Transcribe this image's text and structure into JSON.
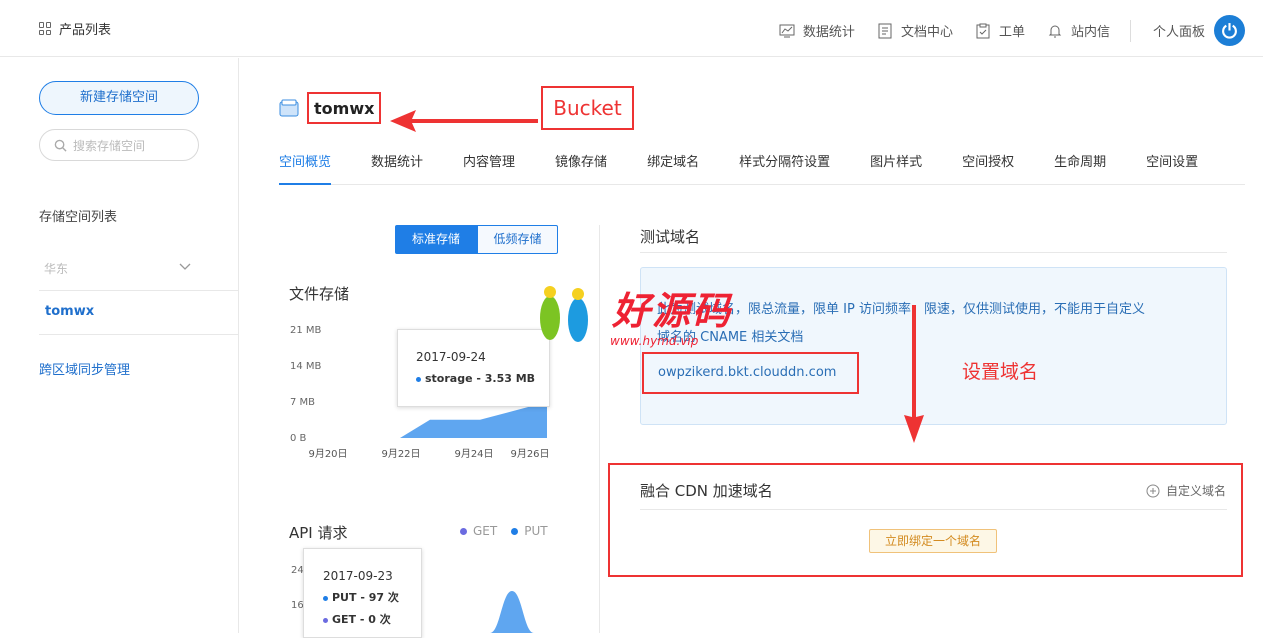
{
  "topbar": {
    "products_label": "产品列表",
    "nav": [
      {
        "label": "数据统计",
        "icon": "chart-icon"
      },
      {
        "label": "文档中心",
        "icon": "document-icon"
      },
      {
        "label": "工单",
        "icon": "ticket-icon"
      },
      {
        "label": "站内信",
        "icon": "bell-icon"
      }
    ],
    "user_panel": "个人面板"
  },
  "sidebar": {
    "new_bucket": "新建存储空间",
    "search_placeholder": "搜索存储空间",
    "list_title": "存储空间列表",
    "region": "华东",
    "bucket": "tomwx",
    "cross_region": "跨区域同步管理"
  },
  "main": {
    "bucket_name": "tomwx",
    "annotation_bucket": "Bucket",
    "tabs": [
      "空间概览",
      "数据统计",
      "内容管理",
      "镜像存储",
      "绑定域名",
      "样式分隔符设置",
      "图片样式",
      "空间授权",
      "生命周期",
      "空间设置"
    ],
    "active_tab": 0,
    "storage_toggle": {
      "standard": "标准存储",
      "low_freq": "低频存储"
    },
    "file_storage_title": "文件存储",
    "storage_tooltip": {
      "date": "2017-09-24",
      "value": "storage - 3.53 MB"
    },
    "api_title": "API 请求",
    "api_legend": [
      "GET",
      "PUT"
    ],
    "api_tooltip": {
      "date": "2017-09-23",
      "put": "PUT - 97 次",
      "get": "GET - 0 次"
    },
    "api_y_labels": [
      "24",
      "16"
    ]
  },
  "test_domain": {
    "title": "测试域名",
    "text_line1": "此为测试域名，限总流量，限单 IP 访问频率，限速，仅供测试使用，不能用于自定义",
    "text_line2": "域名的 CNAME 相关文档",
    "domain": "owpzikerd.bkt.clouddn.com",
    "annotation": "设置域名"
  },
  "cdn": {
    "title": "融合 CDN 加速域名",
    "custom": "自定义域名",
    "bind_button": "立即绑定一个域名"
  },
  "watermark": {
    "text": "好源码",
    "url": "www.hymd.vip"
  },
  "colors": {
    "accent": "#1f7ee6",
    "annotation": "#ee3333",
    "get": "#6b6be0",
    "put": "#1f7ee6"
  },
  "chart_data": {
    "type": "area",
    "title": "文件存储",
    "x": [
      "9月20日",
      "9月22日",
      "9月24日",
      "9月26日"
    ],
    "y_ticks": [
      "21 MB",
      "14 MB",
      "7 MB",
      "0 B"
    ],
    "ylim": [
      0,
      21
    ],
    "series": [
      {
        "name": "storage",
        "values": [
          0,
          0,
          3.53,
          3.53,
          7
        ]
      }
    ]
  }
}
